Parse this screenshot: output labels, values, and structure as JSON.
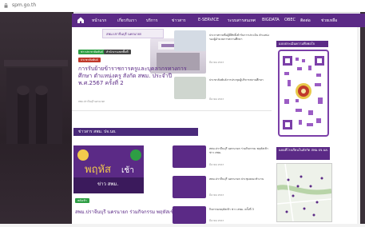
{
  "browser": {
    "url": "spm.go.th"
  },
  "nav": {
    "items": [
      "หน้าแรก",
      "เกี่ยวกับเรา",
      "บริการ",
      "ข่าวสาร",
      "E-SERVICE",
      "ระบบสารสนเทศ",
      "BIGDATA",
      "OBEC",
      "ติดต่อ",
      "ช่วยเหลือ"
    ]
  },
  "top": {
    "banner_text": "สพม.ปราจีนบุรี นครนายก",
    "tag_left": "ข่าวประชาสัมพันธ์",
    "tag_right": "สำนักงานเขตพื้นที่",
    "tag_red": "ประชาสัมพันธ์",
    "headline": "การรับย้ายข้าราชการครูและบุคลากรทางการศึกษา ตำแหน่งครู สังกัด สพม. ประจำปี พ.ศ.2567 ครั้งที่ 2",
    "meta": "สพม.ปราจีนบุรี นครนายก",
    "side_news": [
      {
        "title": "ประกาศรายชื่อผู้มีสิทธิ์เข้ารับการประเมิน ตำแหน่งรองผู้อำนวยการสถานศึกษา",
        "meta": "มีนาคม 2567"
      },
      {
        "title": "ประชาสัมพันธ์การประชุมผู้บริหารสถานศึกษา",
        "meta": "มีนาคม 2567"
      }
    ]
  },
  "section": {
    "title": "ข่าวสาร สพม. ปจ.นย."
  },
  "bottom": {
    "tag": "พลังเช้า",
    "thumb_title": "พฤหัสเช้า ข่าว สพม.",
    "headline": "สพม.ปราจีนบุรี นครนายก ร่วมกิจกรรม พฤหัสเช้า ข่าว สพม.",
    "news": [
      {
        "title": "สพม.ปราจีนบุรี นครนายก ร่วมกิจกรรม พฤหัสเช้าข่าว สพม.",
        "meta": "มีนาคม 2567"
      },
      {
        "title": "สพม.ปราจีนบุรี นครนายก ประชุมคณะทำงาน",
        "meta": "มีนาคม 2567"
      },
      {
        "title": "กิจกรรมพฤหัสเช้า ข่าว สพม. ครั้งที่ 3",
        "meta": "มีนาคม 2567"
      }
    ]
  },
  "sidebar": {
    "qr_title": "แบบประเมินความพึงพอใจ",
    "map_title": "แผนที่โรงเรียนในสังกัด สพม.ปจ.นย."
  },
  "colors": {
    "brand": "#5b2a86",
    "accent": "#c0392b"
  }
}
